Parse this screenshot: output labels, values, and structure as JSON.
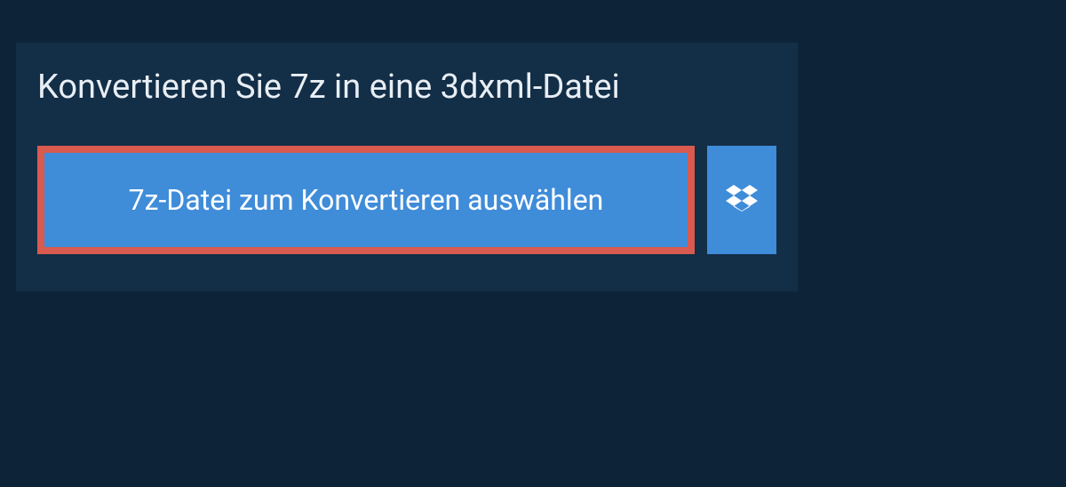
{
  "heading": "Konvertieren Sie 7z in eine 3dxml-Datei",
  "select_button_label": "7z-Datei zum Konvertieren auswählen",
  "colors": {
    "background": "#0d2438",
    "panel": "#132e47",
    "button": "#3f8cd9",
    "highlight_border": "#d95a4f",
    "text_light": "#e8eef4"
  }
}
